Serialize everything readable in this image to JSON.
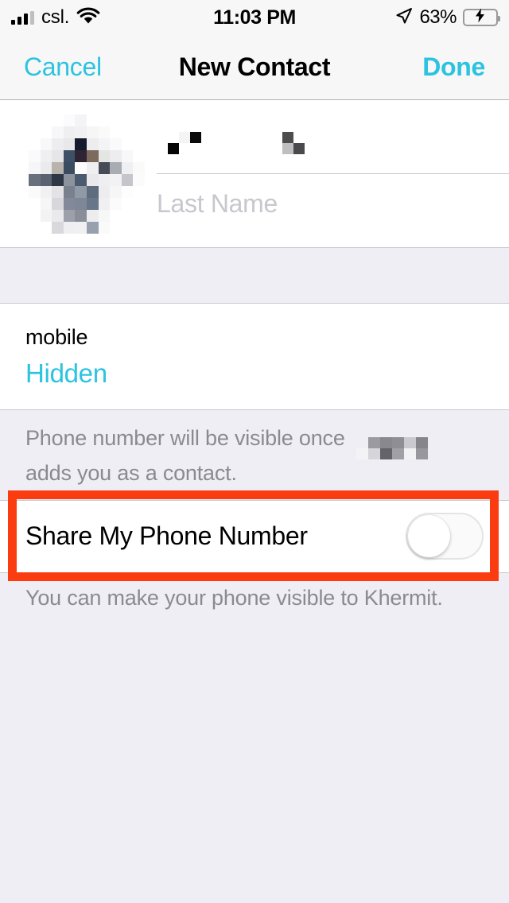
{
  "status_bar": {
    "carrier": "csl.",
    "time": "11:03 PM",
    "battery_percent": "63%",
    "signal_icon": "signal-bars-icon",
    "wifi_icon": "wifi-icon",
    "location_icon": "location-arrow-icon",
    "battery_icon": "battery-charging-icon",
    "battery_fill_color": "#4CD964"
  },
  "nav": {
    "cancel_label": "Cancel",
    "title": "New Contact",
    "done_label": "Done",
    "accent_color": "#2CC3E0"
  },
  "name_section": {
    "avatar_alt": "contact-photo",
    "first_name_value": "",
    "first_name_redacted": true,
    "first_name_placeholder": "First Name",
    "last_name_value": "",
    "last_name_placeholder": "Last Name"
  },
  "phone_section": {
    "label": "mobile",
    "value": "Hidden",
    "value_color": "#2CC3E0"
  },
  "phone_note": {
    "text_before": "Phone number will be visible once",
    "redacted": true,
    "text_after": "adds you as a contact."
  },
  "share_row": {
    "label": "Share My Phone Number",
    "toggle_state": "off",
    "toggle_name": "share-my-phone-number-toggle",
    "annotation_color": "#FA3C10"
  },
  "bottom_note": {
    "text": "You can make your phone visible to Khermit."
  }
}
